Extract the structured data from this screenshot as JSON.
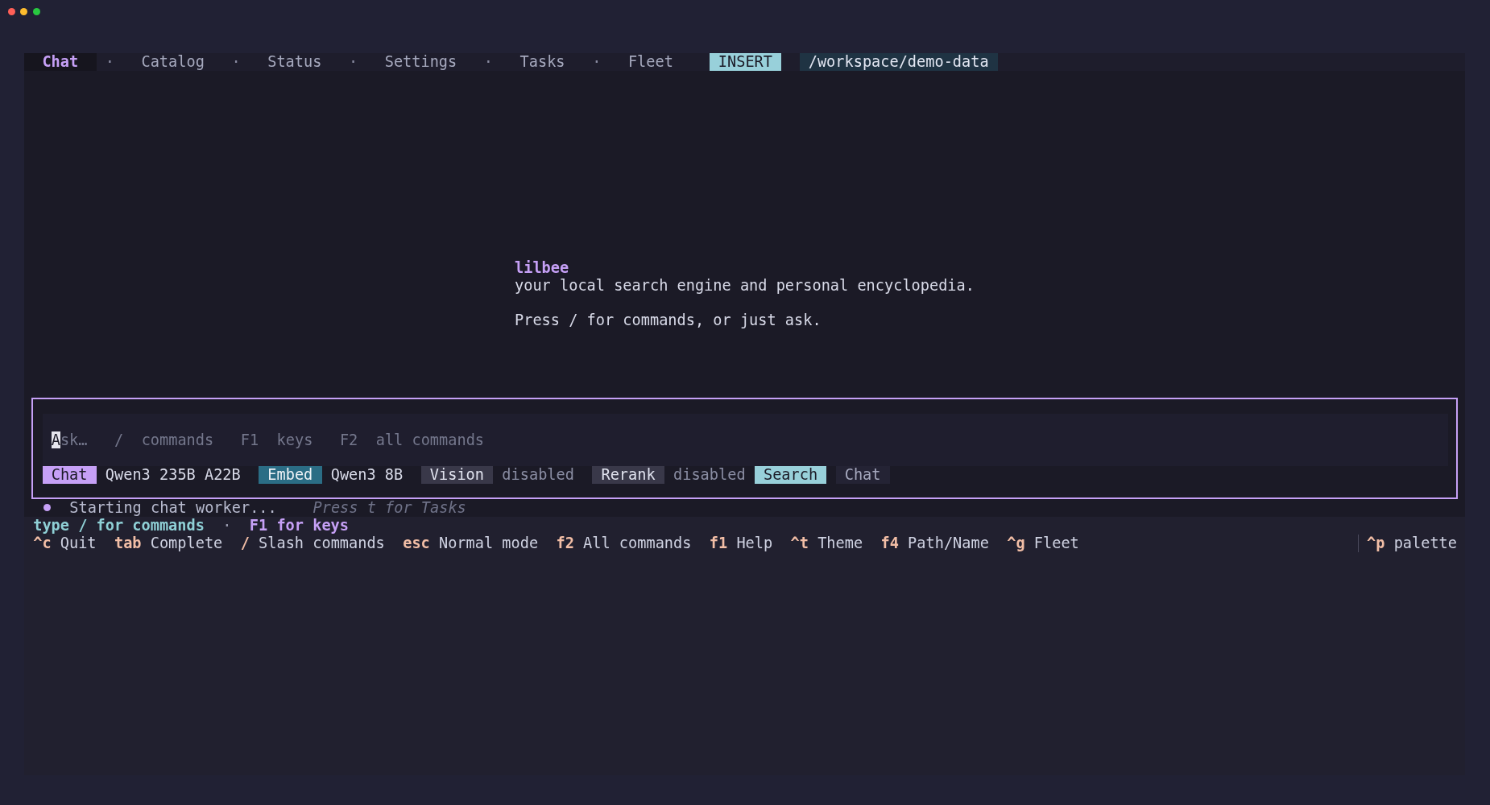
{
  "tabs": [
    {
      "label": "Chat",
      "selected": true
    },
    {
      "label": "Catalog",
      "selected": false
    },
    {
      "label": "Status",
      "selected": false
    },
    {
      "label": "Settings",
      "selected": false
    },
    {
      "label": "Tasks",
      "selected": false
    },
    {
      "label": "Fleet",
      "selected": false
    }
  ],
  "separators": [
    "·",
    "·",
    "·",
    "·",
    "·"
  ],
  "mode": "INSERT",
  "path": "/workspace/demo-data",
  "welcome": {
    "title": "lilbee",
    "tagline": "your local search engine and personal encyclopedia.",
    "hint": "Press / for commands, or just ask."
  },
  "input": {
    "placeholder": "Ask…   /  commands   F1  keys   F2  all commands"
  },
  "models": [
    {
      "role": "Chat",
      "model": "Qwen3 235B A22B",
      "enabled": true,
      "color": "#c6a0f6"
    },
    {
      "role": "Embed",
      "model": "Qwen3 8B",
      "enabled": true,
      "color": "#2b6d85"
    },
    {
      "role": "Vision",
      "model": "disabled",
      "enabled": false
    },
    {
      "role": "Rerank",
      "model": "disabled",
      "enabled": false
    }
  ],
  "mode_toggle": [
    {
      "label": "Search",
      "selected": true
    },
    {
      "label": "Chat",
      "selected": false
    }
  ],
  "status": {
    "message": "Starting chat worker...",
    "hint": "Press t for Tasks"
  },
  "help_line": [
    {
      "text": "type / for commands",
      "kind": "command"
    },
    {
      "text": "·",
      "kind": "separator"
    },
    {
      "text": "F1 for keys",
      "kind": "key"
    }
  ],
  "key_hints": [
    {
      "key": "^c",
      "label": "Quit"
    },
    {
      "key": "tab",
      "label": "Complete"
    },
    {
      "key": "/",
      "label": "Slash commands"
    },
    {
      "key": "esc",
      "label": "Normal mode"
    },
    {
      "key": "f2",
      "label": "All commands"
    },
    {
      "key": "f1",
      "label": "Help"
    },
    {
      "key": "^t",
      "label": "Theme"
    },
    {
      "key": "f4",
      "label": "Path/Name"
    },
    {
      "key": "^g",
      "label": "Fleet"
    }
  ],
  "palette_hint": {
    "key": "^p",
    "label": "palette"
  }
}
